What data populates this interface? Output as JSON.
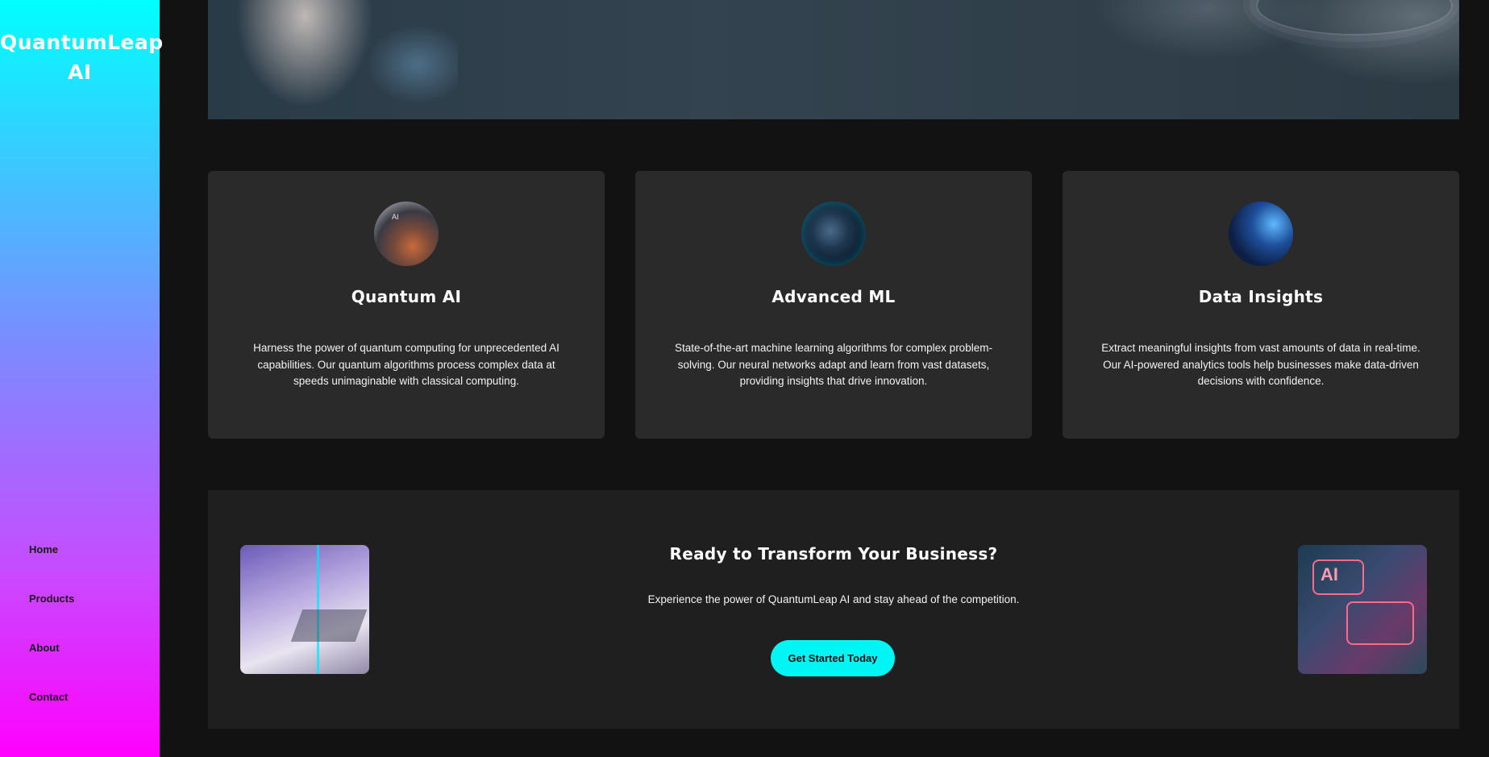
{
  "brand": {
    "name_line1": "QuantumLeap",
    "name_line2": "AI"
  },
  "nav": {
    "items": [
      {
        "label": "Home"
      },
      {
        "label": "Products"
      },
      {
        "label": "About"
      },
      {
        "label": "Contact"
      }
    ]
  },
  "features": [
    {
      "title": "Quantum AI",
      "text": "Harness the power of quantum computing for unprecedented AI capabilities. Our quantum algorithms process complex data at speeds unimaginable with classical computing.",
      "image_label": "AI"
    },
    {
      "title": "Advanced ML",
      "text": "State-of-the-art machine learning algorithms for complex problem-solving. Our neural networks adapt and learn from vast datasets, providing insights that drive innovation."
    },
    {
      "title": "Data Insights",
      "text": "Extract meaningful insights from vast amounts of data in real-time. Our AI-powered analytics tools help businesses make data-driven decisions with confidence."
    }
  ],
  "cta": {
    "title": "Ready to Transform Your Business?",
    "text": "Experience the power of QuantumLeap AI and stay ahead of the competition.",
    "button_label": "Get Started Today",
    "right_image_label": "AI"
  },
  "colors": {
    "accent": "#00f5f5",
    "sidebar_top": "#00ffff",
    "sidebar_bottom": "#ff00ff",
    "page_background": "#121212",
    "card_background": "#2a2a2a"
  }
}
